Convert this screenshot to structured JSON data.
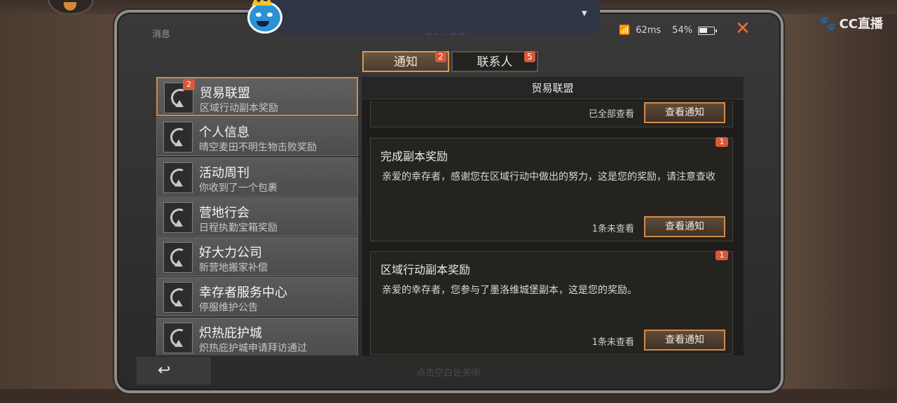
{
  "status": {
    "left_label": "消息",
    "time": "15:21",
    "ping": "62ms",
    "battery": "54%"
  },
  "overlay": {
    "brand": "CC直播"
  },
  "tabs": [
    {
      "label": "通知",
      "badge": "2"
    },
    {
      "label": "联系人",
      "badge": "5"
    }
  ],
  "list": [
    {
      "title": "贸易联盟",
      "subtitle": "区域行动副本奖励",
      "badge": "2"
    },
    {
      "title": "个人信息",
      "subtitle": "晴空麦田不明生物击败奖励"
    },
    {
      "title": "活动周刊",
      "subtitle": "你收到了一个包裹"
    },
    {
      "title": "营地行会",
      "subtitle": "日程执勤宝箱奖励"
    },
    {
      "title": "好大力公司",
      "subtitle": "新营地搬家补偿"
    },
    {
      "title": "幸存者服务中心",
      "subtitle": "停服维护公告"
    },
    {
      "title": "炽热庇护城",
      "subtitle": "炽热庇护城申请拜访通过"
    }
  ],
  "detail": {
    "header": "贸易联盟",
    "cards": [
      {
        "status": "已全部查看",
        "button": "查看通知"
      },
      {
        "title": "完成副本奖励",
        "body": "亲爱的幸存者，感谢您在区域行动中做出的努力，这是您的奖励，请注意查收",
        "status": "1条未查看",
        "button": "查看通知",
        "badge": "1"
      },
      {
        "title": "区域行动副本奖励",
        "body": "亲爱的幸存者，您参与了墨洛维城堡副本，这是您的奖励。",
        "status": "1条未查看",
        "button": "查看通知",
        "badge": "1"
      }
    ]
  },
  "footer": {
    "back_icon": "↩",
    "hint": "点击空白处关闭"
  },
  "colors": {
    "accent": "#d48c47",
    "badge": "#d9573a",
    "close": "#e8703a"
  }
}
